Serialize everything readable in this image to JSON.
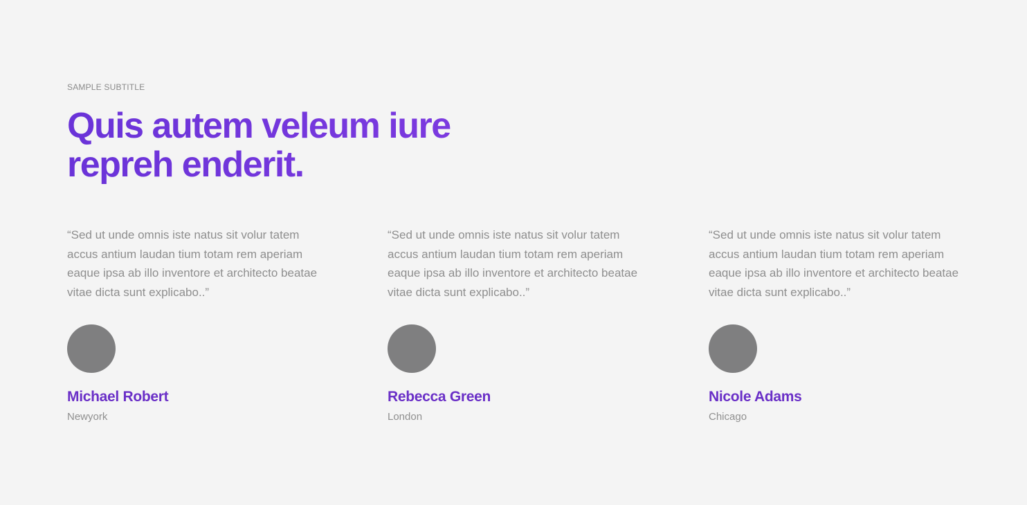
{
  "colors": {
    "background": "#f4f4f4",
    "accent": "#7433d6",
    "muted_text": "#8e8e8e",
    "avatar_placeholder": "#7f7f80"
  },
  "header": {
    "subtitle": "SAMPLE SUBTITLE",
    "title": "Quis autem veleum iure repreh enderit."
  },
  "testimonials": [
    {
      "quote": "“Sed ut unde omnis iste natus sit volur tatem accus antium laudan tium totam rem aperiam eaque ipsa ab illo inventore et architecto beatae vitae dicta sunt explicabo..”",
      "name": "Michael Robert",
      "city": "Newyork"
    },
    {
      "quote": "“Sed ut unde omnis iste natus sit volur tatem accus antium laudan tium totam rem aperiam eaque ipsa ab illo inventore et architecto beatae vitae dicta sunt explicabo..”",
      "name": "Rebecca Green",
      "city": "London"
    },
    {
      "quote": "“Sed ut unde omnis iste natus sit volur tatem accus antium laudan tium totam rem aperiam eaque ipsa ab illo inventore et architecto beatae vitae dicta sunt explicabo..”",
      "name": "Nicole Adams",
      "city": "Chicago"
    }
  ]
}
